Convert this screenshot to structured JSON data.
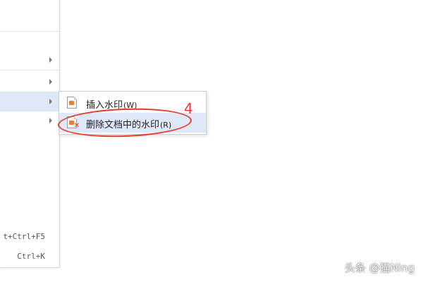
{
  "parent_menu": {
    "shortcuts": [
      "t+Ctrl+F5",
      "Ctrl+K"
    ]
  },
  "submenu": {
    "items": [
      {
        "label": "插入水印",
        "accelerator": "(W)",
        "icon": "insert-watermark-icon"
      },
      {
        "label": "删除文档中的水印",
        "accelerator": "(R)",
        "icon": "remove-watermark-icon"
      }
    ]
  },
  "annotation": {
    "number": "4",
    "color": "#e23c2c"
  },
  "watermark": {
    "text": "头条 @猫Ning"
  },
  "colors": {
    "highlight": "#dfe8f8",
    "menu_border": "#cfcfcf"
  }
}
